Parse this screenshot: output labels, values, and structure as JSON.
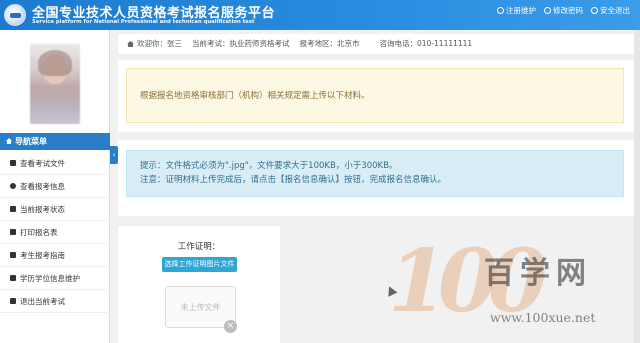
{
  "header": {
    "title_cn": "全国专业技术人员资格考试报名服务平台",
    "title_en": "Service platform for National Professional and technican qualification test",
    "links": [
      {
        "label": "注册维护",
        "icon": "register-icon"
      },
      {
        "label": "修改密码",
        "icon": "key-icon"
      },
      {
        "label": "安全退出",
        "icon": "power-icon"
      }
    ]
  },
  "infobar": {
    "welcome_label": "欢迎你：",
    "welcome_value": "张三",
    "exam_label": "当前考试：",
    "exam_value": "执业药师资格考试",
    "region_label": "报考地区：",
    "region_value": "北京市",
    "phone_label": "咨询电话：",
    "phone_value": "010-11111111"
  },
  "sidebar": {
    "nav_title": "导航菜单",
    "collapse_icon": "‹",
    "items": [
      {
        "label": "查看考试文件",
        "icon": "file-icon"
      },
      {
        "label": "查看报考信息",
        "icon": "info-icon"
      },
      {
        "label": "当前报考状态",
        "icon": "monitor-icon"
      },
      {
        "label": "打印报名表",
        "icon": "print-icon"
      },
      {
        "label": "考生报考指南",
        "icon": "guide-icon"
      },
      {
        "label": "学历学位信息维护",
        "icon": "graduation-icon"
      },
      {
        "label": "退出当前考试",
        "icon": "exit-icon"
      }
    ]
  },
  "notice": {
    "warning": "根据报名地资格审核部门（机构）相关规定需上传以下材料。",
    "tip_line1": "提示：文件格式必须为\".jpg\"，文件要求大于100KB，小于300KB。",
    "tip_line2": "注意：证明材料上传完成后，请点击【报名信息确认】按钮，完成报名信息确认。"
  },
  "upload": {
    "title": "工作证明：",
    "button_label": "选择工作证明图片文件",
    "placeholder": "未上传文件",
    "close_glyph": "×"
  },
  "watermark": {
    "number": "100",
    "cn": "百学网",
    "url": "www.100xue.net"
  },
  "colors": {
    "header_blue": "#1c7bcf",
    "nav_blue": "#2a7ec9",
    "warning_bg": "#fcf8e3",
    "info_bg": "#d9edf7",
    "upload_button": "#2ea7d8"
  }
}
